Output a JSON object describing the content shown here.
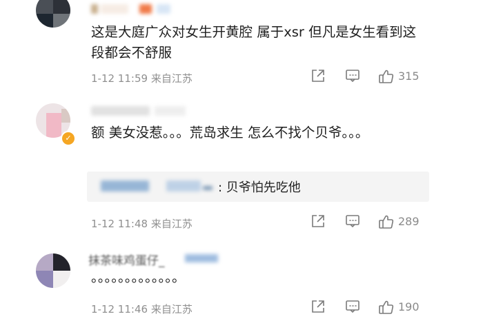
{
  "comments": [
    {
      "text": "这是大庭广众对女生开黄腔 属于xsr 但凡是女生看到这段都会不舒服",
      "time": "1-12 11:59",
      "location": "来自江苏",
      "likes": "315"
    },
    {
      "text": "额 美女没惹。。。荒岛求生 怎么不找个贝爷。。。",
      "time": "1-12 11:48",
      "location": "来自江苏",
      "likes": "289",
      "reply": {
        "text": ": 贝爷怕先吃他"
      }
    },
    {
      "username": "抹茶味鸡蛋仔_",
      "text": "。。。。。。。。。。。。。",
      "time": "1-12 11:46",
      "location": "来自江苏",
      "likes": "190"
    }
  ],
  "icons": {
    "share": "share-icon",
    "comment": "comment-icon",
    "like": "thumbs-up-icon",
    "badge": "verified-badge-icon"
  },
  "colors": {
    "meta_gray": "#8f8f8f",
    "badge_orange": "#f5a623",
    "reply_bg": "#f4f4f4"
  }
}
